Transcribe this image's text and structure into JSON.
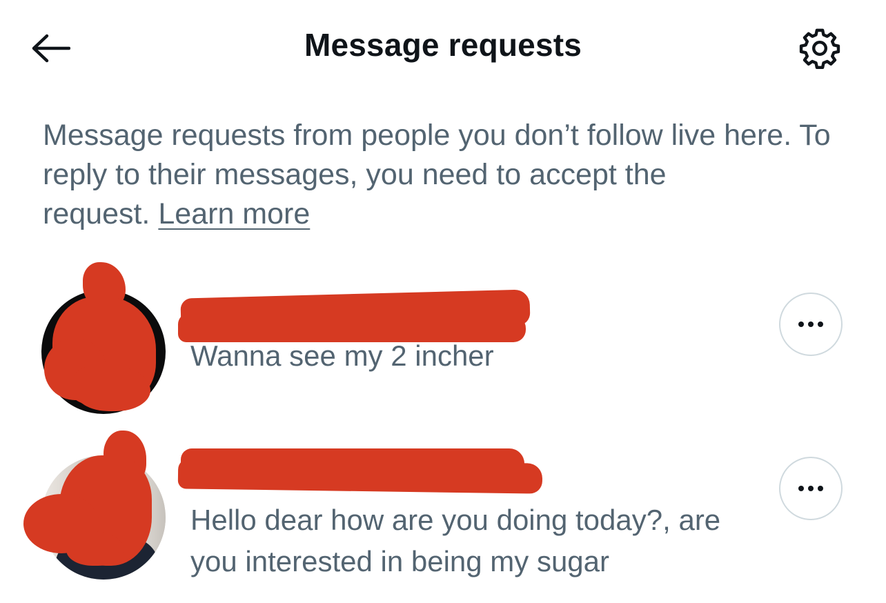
{
  "header": {
    "title": "Message requests",
    "back_icon": "arrow-left-icon",
    "settings_icon": "gear-icon"
  },
  "info": {
    "text": "Message requests from people you don’t follow live here. To reply to their messages, you need to accept the request.",
    "learn_more": "Learn more"
  },
  "requests": [
    {
      "preview": "Wanna see my 2 incher",
      "more_icon": "more-horizontal-icon"
    },
    {
      "preview": "Hello dear how are you doing today?, are you interested in being my sugar",
      "more_icon": "more-horizontal-icon"
    }
  ],
  "colors": {
    "text_primary": "#0f1419",
    "text_secondary": "#536471",
    "border": "#cfd9de",
    "redaction": "#d63a22"
  }
}
